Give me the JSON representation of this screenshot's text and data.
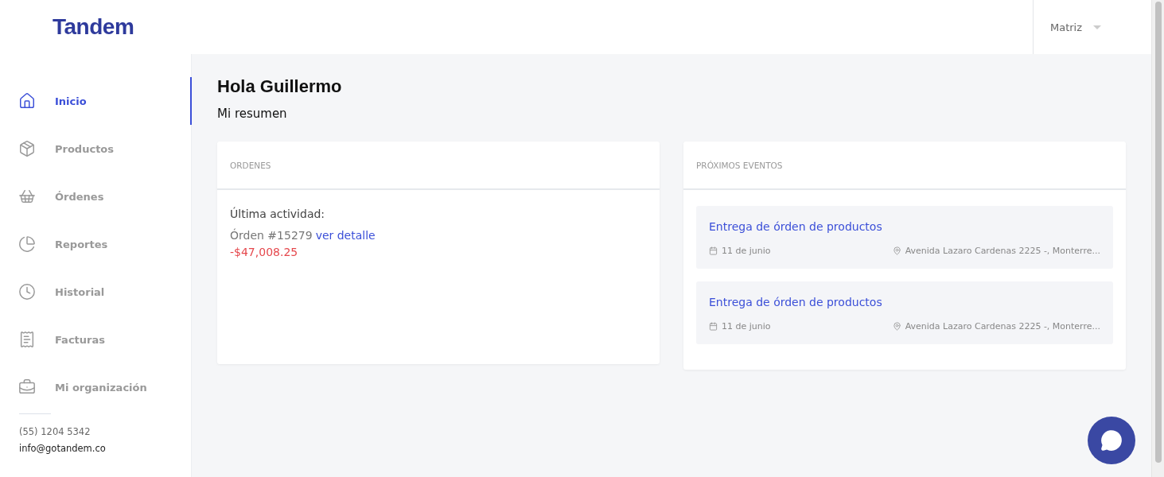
{
  "header": {
    "logo": "Tandem",
    "branch": "Matriz"
  },
  "sidebar": {
    "items": [
      {
        "label": "Inicio",
        "selected": true
      },
      {
        "label": "Productos",
        "selected": false
      },
      {
        "label": "Órdenes",
        "selected": false
      },
      {
        "label": "Reportes",
        "selected": false
      },
      {
        "label": "Historial",
        "selected": false
      },
      {
        "label": "Facturas",
        "selected": false
      },
      {
        "label": "Mi organización",
        "selected": false
      }
    ],
    "phone": "(55) 1204 5342",
    "email": "info@gotandem.co"
  },
  "main": {
    "greeting": "Hola Guillermo",
    "subtitle": "Mi resumen",
    "orders": {
      "title": "ORDENES",
      "activity_label": "Última actividad:",
      "order": "Órden #15279",
      "link": "ver detalle",
      "amount": "-$47,008.25"
    },
    "events": {
      "title": "PRÓXIMOS EVENTOS",
      "items": [
        {
          "title": "Entrega de órden de productos",
          "date": "11 de junio",
          "location": "Avenida Lazaro Cardenas 2225 -, Monterre..."
        },
        {
          "title": "Entrega de órden de productos",
          "date": "11 de junio",
          "location": "Avenida Lazaro Cardenas 2225 -, Monterre..."
        }
      ]
    }
  }
}
